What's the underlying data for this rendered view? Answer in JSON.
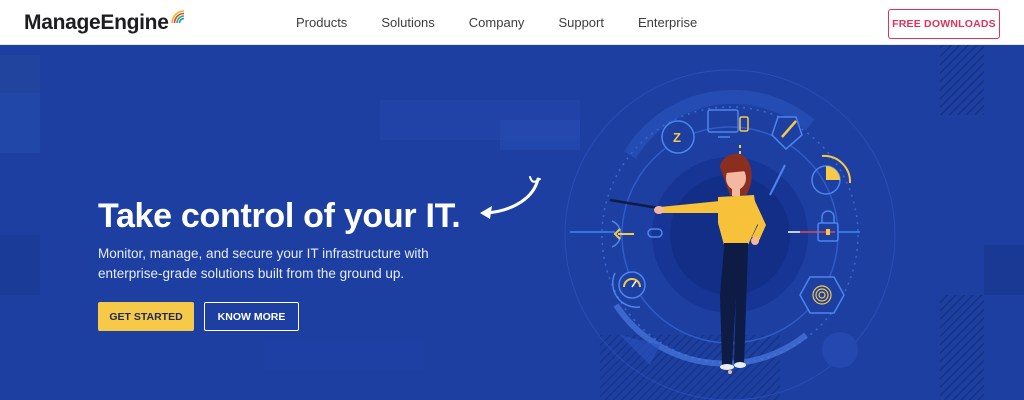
{
  "header": {
    "logo_text": "ManageEngine",
    "nav": [
      "Products",
      "Solutions",
      "Company",
      "Support",
      "Enterprise"
    ],
    "cta_label": "FREE DOWNLOADS"
  },
  "hero": {
    "headline": "Take control of your IT.",
    "subheadline": "Monitor, manage, and secure your IT infrastructure with enterprise-grade solutions built from the ground up.",
    "primary_button": "GET STARTED",
    "secondary_button": "KNOW MORE"
  },
  "colors": {
    "hero_bg": "#1d3fa2",
    "accent_yellow": "#f7c948",
    "download_red": "#e2325a",
    "logo_arcs": [
      "#f0b323",
      "#e23c3c",
      "#2db34a",
      "#1e88e5"
    ]
  },
  "icons": [
    "logo-arcs-icon",
    "curved-arrow-icon",
    "chat-z-icon",
    "monitor-phone-icon",
    "magnify-pen-icon",
    "pie-chart-icon",
    "lock-icon",
    "fingerprint-icon",
    "gauge-icon",
    "key-arrow-icon"
  ]
}
